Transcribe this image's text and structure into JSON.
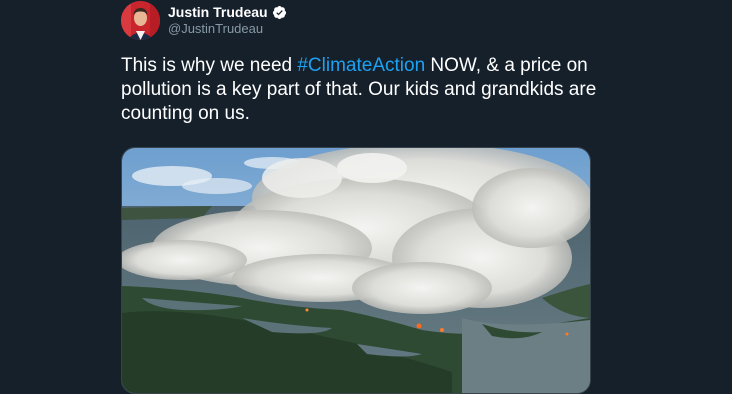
{
  "author": {
    "display_name": "Justin Trudeau",
    "handle": "@JustinTrudeau",
    "verified": true,
    "avatar_icon": "profile-photo-avatar"
  },
  "tweet": {
    "text_before": "This is why we need ",
    "hashtag": "#ClimateAction",
    "text_after": " NOW, & a price on pollution is a key part of that. Our kids and grandkids are counting on us."
  },
  "media": {
    "description_icon": "forest-fire-smoke-photo"
  },
  "colors": {
    "background": "#15202b",
    "primary_text": "#ffffff",
    "secondary_text": "#8899a6",
    "link": "#1da1f2",
    "verified_badge": "#ffffff"
  }
}
